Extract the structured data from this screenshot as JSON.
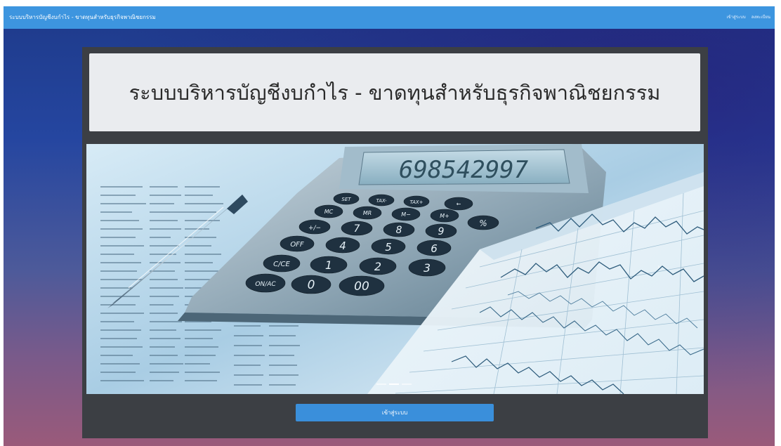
{
  "navbar": {
    "brand": "ระบบบริหารบัญชีงบกำไร - ขาดทุนสำหรับธุรกิจพาณิชยกรรม",
    "links": [
      "เข้าสู่ระบบ",
      "ลงทะเบียน"
    ]
  },
  "main": {
    "title": "ระบบบริหารบัญชีงบกำไร - ขาดทุนสำหรับธุรกิจพาณิชยกรรม",
    "login_label": "เข้าสู่ระบบ"
  },
  "carousel": {
    "calculator_display": "698542997",
    "slide_count": 3,
    "active_slide": 2,
    "keys": [
      [
        "SET",
        "TAX-",
        "TAX+"
      ],
      [
        "MC",
        "MR",
        "M−",
        "M+",
        "←"
      ],
      [
        "+/−",
        "7",
        "8",
        "9",
        "%"
      ],
      [
        "OFF",
        "4",
        "5",
        "6"
      ],
      [
        "C/CE",
        "1",
        "2",
        "3"
      ],
      [
        "ON/AC",
        "0",
        "00"
      ]
    ]
  },
  "colors": {
    "navbar": "#3d95df",
    "panel": "#3c3f44",
    "title_box": "#eaecef",
    "button": "#3a8fdb"
  }
}
